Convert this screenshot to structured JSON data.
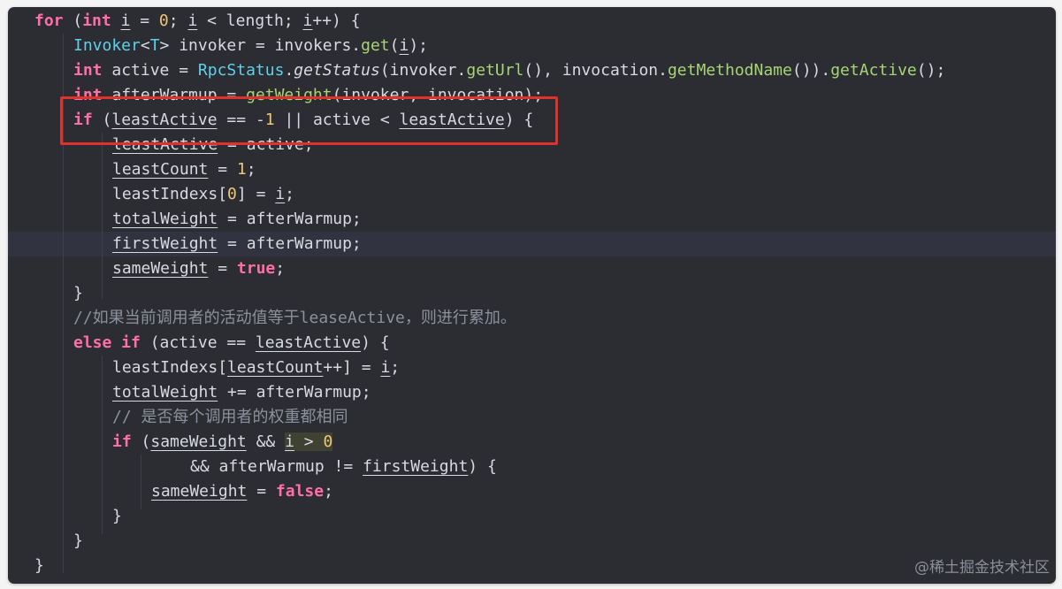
{
  "code_lines": [
    [
      {
        "t": "for",
        "c": "kw"
      },
      {
        "t": " ("
      },
      {
        "t": "int",
        "c": "kw"
      },
      {
        "t": " "
      },
      {
        "t": "i",
        "c": "u"
      },
      {
        "t": " = "
      },
      {
        "t": "0",
        "c": "num"
      },
      {
        "t": "; "
      },
      {
        "t": "i",
        "c": "u"
      },
      {
        "t": " < length; "
      },
      {
        "t": "i",
        "c": "u"
      },
      {
        "t": "++) {"
      }
    ],
    [
      {
        "t": "Invoker",
        "c": "ty"
      },
      {
        "t": "<"
      },
      {
        "t": "T",
        "c": "ty"
      },
      {
        "t": "> invoker = invokers."
      },
      {
        "t": "get",
        "c": "fn"
      },
      {
        "t": "("
      },
      {
        "t": "i",
        "c": "u"
      },
      {
        "t": ");"
      }
    ],
    [
      {
        "t": "int",
        "c": "kw"
      },
      {
        "t": " active = "
      },
      {
        "t": "RpcStatus",
        "c": "ty"
      },
      {
        "t": "."
      },
      {
        "t": "getStatus",
        "c": "it"
      },
      {
        "t": "(invoker."
      },
      {
        "t": "getUrl",
        "c": "fn"
      },
      {
        "t": "(), invocation."
      },
      {
        "t": "getMethodName",
        "c": "fn"
      },
      {
        "t": "())."
      },
      {
        "t": "getActive",
        "c": "fn"
      },
      {
        "t": "();"
      }
    ],
    [
      {
        "t": "int",
        "c": "kw"
      },
      {
        "t": " afterWarmup = "
      },
      {
        "t": "getWeight",
        "c": "fn"
      },
      {
        "t": "(invoker, invocation);"
      }
    ],
    [
      {
        "t": "if",
        "c": "kw"
      },
      {
        "t": " ("
      },
      {
        "t": "leastActive",
        "c": "u"
      },
      {
        "t": " == -"
      },
      {
        "t": "1",
        "c": "num"
      },
      {
        "t": " || active < "
      },
      {
        "t": "leastActive",
        "c": "u"
      },
      {
        "t": ") {"
      }
    ],
    [
      {
        "t": "leastActive",
        "c": "u"
      },
      {
        "t": " = active;"
      }
    ],
    [
      {
        "t": "leastCount",
        "c": "u"
      },
      {
        "t": " = "
      },
      {
        "t": "1",
        "c": "num"
      },
      {
        "t": ";"
      }
    ],
    [
      {
        "t": "leastIndexs["
      },
      {
        "t": "0",
        "c": "num"
      },
      {
        "t": "] = "
      },
      {
        "t": "i",
        "c": "u"
      },
      {
        "t": ";"
      }
    ],
    [
      {
        "t": "totalWeight",
        "c": "u"
      },
      {
        "t": " = afterWarmup;"
      }
    ],
    [
      {
        "t": "firstWeight",
        "c": "u"
      },
      {
        "t": " = afterWarmup;"
      }
    ],
    [
      {
        "t": "sameWeight",
        "c": "u"
      },
      {
        "t": " = "
      },
      {
        "t": "true",
        "c": "kw"
      },
      {
        "t": ";"
      }
    ],
    [
      {
        "t": "}"
      }
    ],
    [
      {
        "t": "//如果当前调用者的活动值等于leaseActive，则进行累加。",
        "c": "cm"
      }
    ],
    [
      {
        "t": "else if",
        "c": "kw"
      },
      {
        "t": " (active == "
      },
      {
        "t": "leastActive",
        "c": "u"
      },
      {
        "t": ") {"
      }
    ],
    [
      {
        "t": "leastIndexs["
      },
      {
        "t": "leastCount",
        "c": "u"
      },
      {
        "t": "++] = "
      },
      {
        "t": "i",
        "c": "u"
      },
      {
        "t": ";"
      }
    ],
    [
      {
        "t": "totalWeight",
        "c": "u"
      },
      {
        "t": " += afterWarmup;"
      }
    ],
    [
      {
        "t": "// 是否每个调用者的权重都相同",
        "c": "cm"
      }
    ],
    [
      {
        "t": "if",
        "c": "kw"
      },
      {
        "t": " ("
      },
      {
        "t": "sameWeight",
        "c": "u"
      },
      {
        "t": " && "
      },
      {
        "t": "i",
        "c": "u hl"
      },
      {
        "t": " > ",
        "c": "hl"
      },
      {
        "t": "0",
        "c": "num hl"
      }
    ],
    [
      {
        "t": "&& afterWarmup != "
      },
      {
        "t": "firstWeight",
        "c": "u"
      },
      {
        "t": ") {"
      }
    ],
    [
      {
        "t": "sameWeight",
        "c": "u"
      },
      {
        "t": " = "
      },
      {
        "t": "false",
        "c": "kw"
      },
      {
        "t": ";"
      }
    ],
    [
      {
        "t": "}"
      }
    ],
    [
      {
        "t": "}"
      }
    ],
    [
      {
        "t": "}"
      }
    ]
  ],
  "watermark": "@稀土掘金技术社区",
  "colors": {
    "background": "#2b2d33",
    "keyword": "#ff6ea7",
    "type": "#5fd0ea",
    "method": "#a8d474",
    "number": "#f0c674",
    "comment": "#8b919d",
    "highlight_box": "#e0322c"
  }
}
